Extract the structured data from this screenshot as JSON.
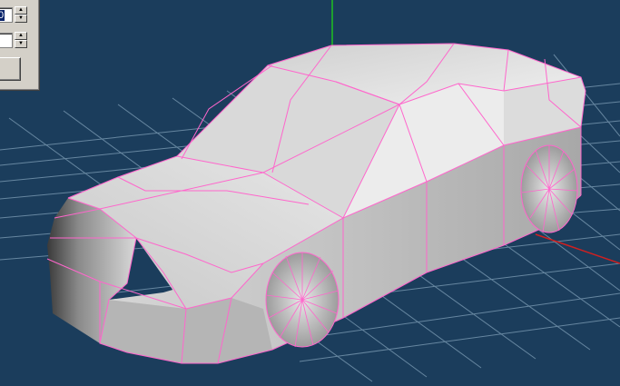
{
  "panel": {
    "field_1": {
      "value": "0"
    },
    "field_2": {
      "value": ""
    },
    "action_button": {
      "label": ""
    }
  },
  "viewport": {
    "background": "#1b3d5c",
    "grid_color": "#6f8fa8",
    "wire_color": "#ff66cc",
    "axis_x_color": "#d02020",
    "axis_z_color": "#20c020"
  }
}
